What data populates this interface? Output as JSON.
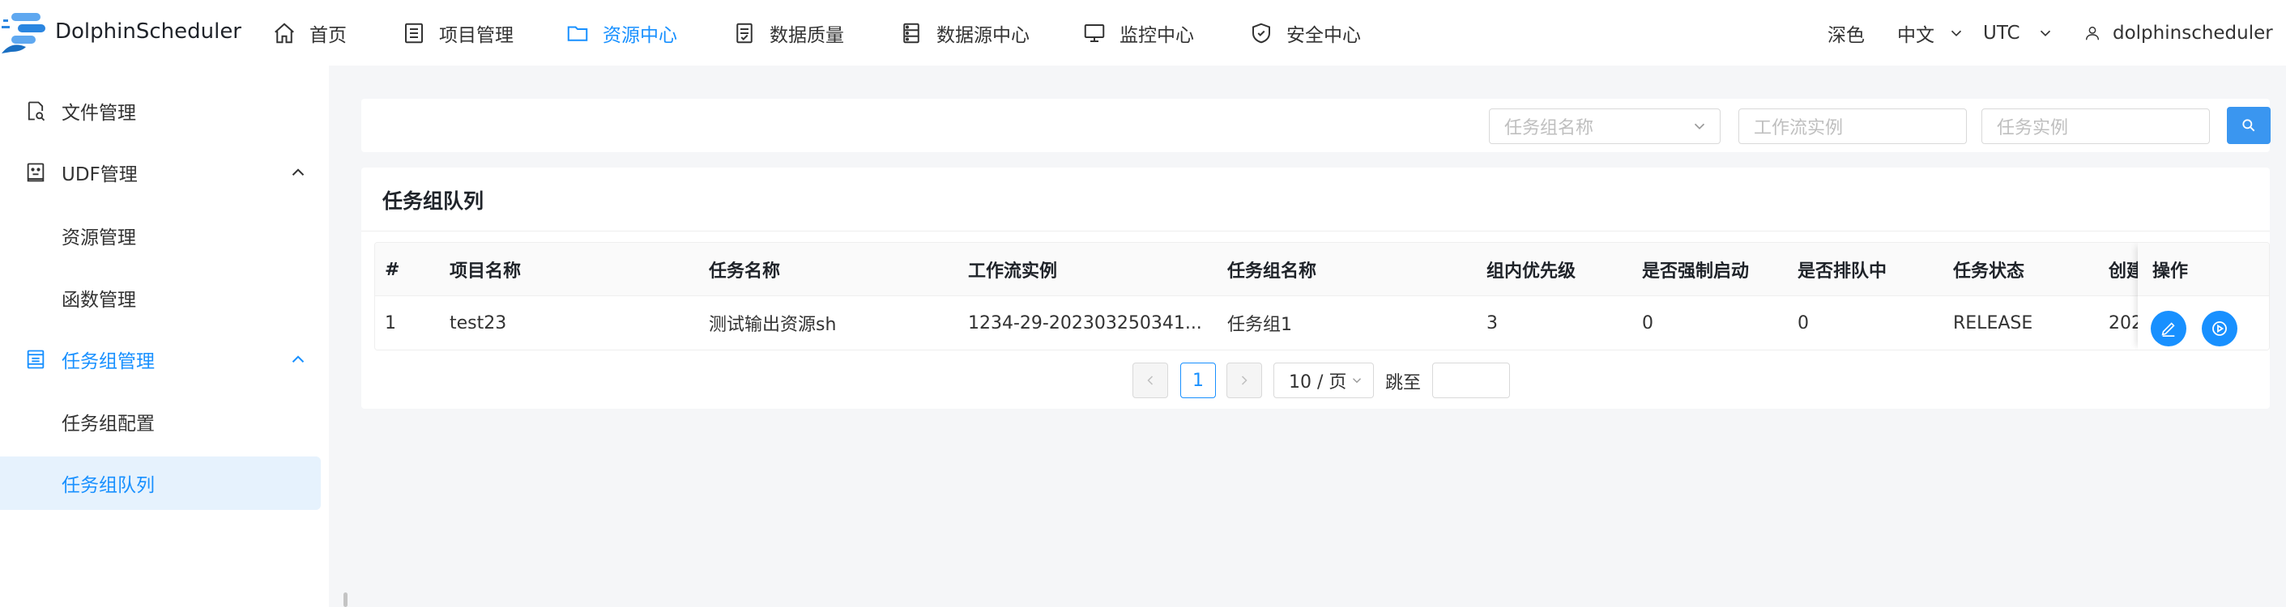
{
  "header": {
    "logo_text": "DolphinScheduler",
    "nav": [
      {
        "label": "首页",
        "icon": "home-icon"
      },
      {
        "label": "项目管理",
        "icon": "project-list-icon"
      },
      {
        "label": "资源中心",
        "icon": "folder-icon",
        "active": true
      },
      {
        "label": "数据质量",
        "icon": "document-check-icon"
      },
      {
        "label": "数据源中心",
        "icon": "database-icon"
      },
      {
        "label": "监控中心",
        "icon": "monitor-icon"
      },
      {
        "label": "安全中心",
        "icon": "shield-icon"
      }
    ],
    "theme_label": "深色",
    "language": "中文",
    "timezone": "UTC",
    "user": "dolphinscheduler"
  },
  "sidebar": {
    "items": [
      {
        "label": "文件管理",
        "icon": "file-search-icon"
      },
      {
        "label": "UDF管理",
        "icon": "udf-icon"
      },
      {
        "label": "资源管理"
      },
      {
        "label": "函数管理"
      },
      {
        "label": "任务组管理",
        "icon": "task-group-icon"
      },
      {
        "label": "任务组配置"
      },
      {
        "label": "任务组队列"
      }
    ]
  },
  "search": {
    "group_name_placeholder": "任务组名称",
    "workflow_instance_placeholder": "工作流实例",
    "task_instance_placeholder": "任务实例"
  },
  "list": {
    "title": "任务组队列",
    "columns": [
      "#",
      "项目名称",
      "任务名称",
      "工作流实例",
      "任务组名称",
      "组内优先级",
      "是否强制启动",
      "是否排队中",
      "任务状态",
      "创建",
      "操作"
    ],
    "rows": [
      [
        "1",
        "test23",
        "测试输出资源sh",
        "1234-29-202303250341...",
        "任务组1",
        "3",
        "0",
        "0",
        "RELEASE",
        "202"
      ]
    ]
  },
  "pagination": {
    "current_page": "1",
    "page_size": "10 / 页",
    "jump_label": "跳至"
  },
  "colors": {
    "accent": "#1890ff",
    "selected_bg": "#e6f2fd"
  }
}
